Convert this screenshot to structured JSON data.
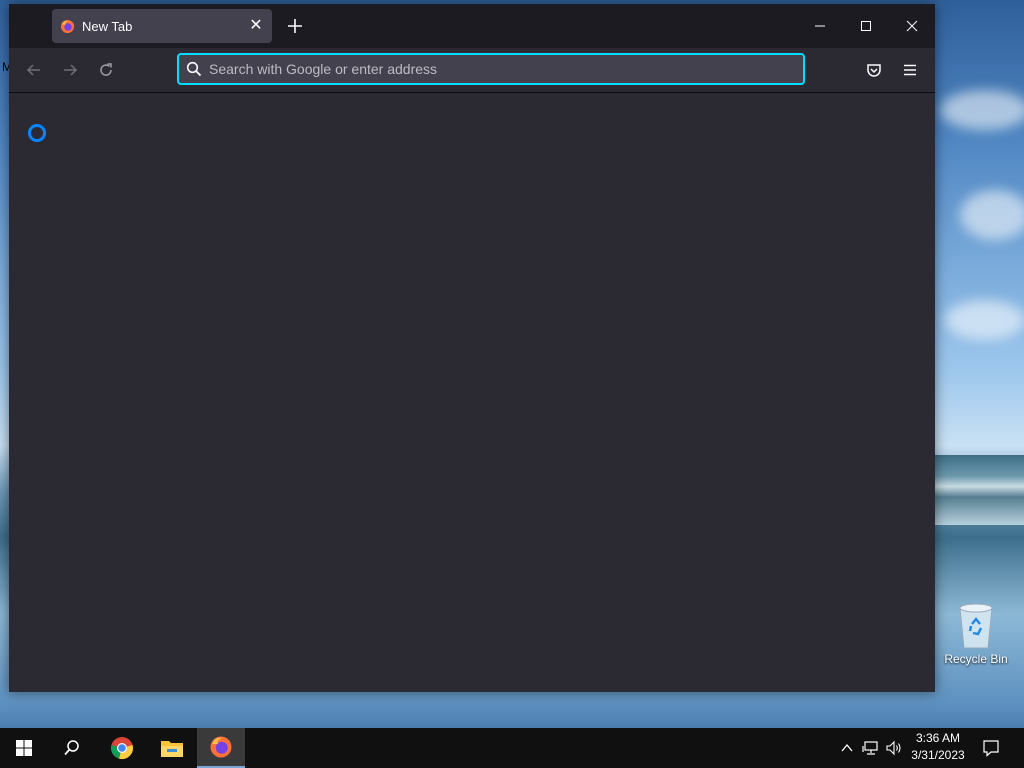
{
  "browser": {
    "tab": {
      "title": "New Tab"
    },
    "urlbar": {
      "placeholder": "Search with Google or enter address",
      "value": ""
    }
  },
  "desktop": {
    "edge_text_top": "M",
    "recycle_bin_label": "Recycle Bin"
  },
  "taskbar": {
    "time": "3:36 AM",
    "date": "3/31/2023"
  },
  "colors": {
    "accent_focus": "#00ddff",
    "spinner": "#0a84ff",
    "window_bg": "#2b2a33",
    "titlebar_bg": "#1c1b22"
  }
}
